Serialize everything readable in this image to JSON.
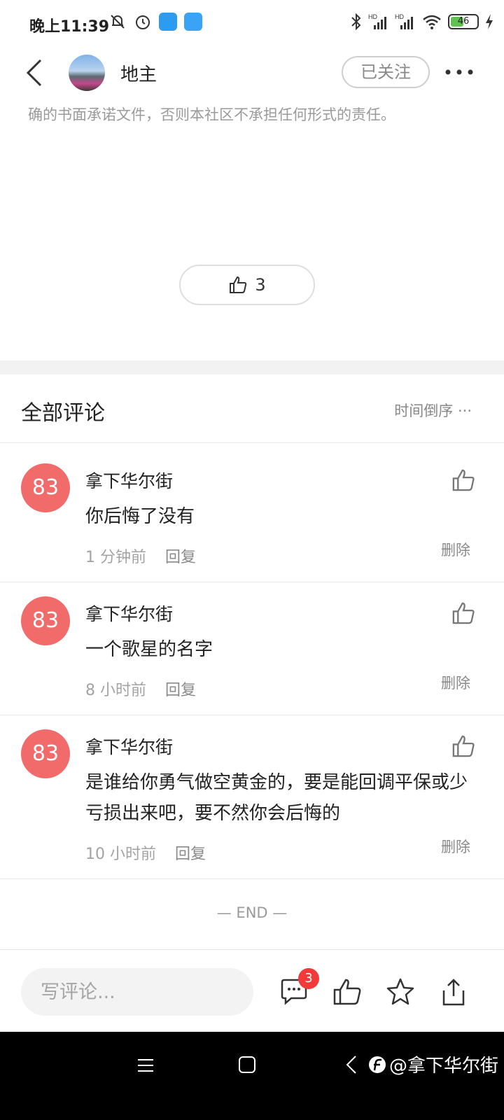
{
  "status_bar": {
    "time": "晚上11:39",
    "battery_level": "46",
    "signal_labels": [
      "HD",
      "HD"
    ]
  },
  "header": {
    "author_name": "地主",
    "follow_label": "已关注"
  },
  "post": {
    "disclaimer": "确的书面承诺文件，否则本社区不承担任何形式的责任。",
    "like_count": "3"
  },
  "comments_section": {
    "title": "全部评论",
    "sort_label": "时间倒序 ···",
    "items": [
      {
        "avatar_text": "83",
        "name": "拿下华尔街",
        "text": "你后悔了没有",
        "time": "1 分钟前",
        "reply_label": "回复",
        "delete_label": "删除"
      },
      {
        "avatar_text": "83",
        "name": "拿下华尔街",
        "text": "一个歌星的名字",
        "time": "8 小时前",
        "reply_label": "回复",
        "delete_label": "删除"
      },
      {
        "avatar_text": "83",
        "name": "拿下华尔街",
        "text": "是谁给你勇气做空黄金的，要是能回调平保或少亏损出来吧，要不然你会后悔的",
        "time": "10 小时前",
        "reply_label": "回复",
        "delete_label": "删除"
      }
    ],
    "end_label": "— END —"
  },
  "bottom_bar": {
    "input_placeholder": "写评论...",
    "comment_badge": "3"
  },
  "watermark": {
    "text": "@拿下华尔街"
  },
  "colors": {
    "avatar_bg": "#f26b6b",
    "badge_bg": "#f23a3a",
    "battery_fill": "#61c152"
  }
}
